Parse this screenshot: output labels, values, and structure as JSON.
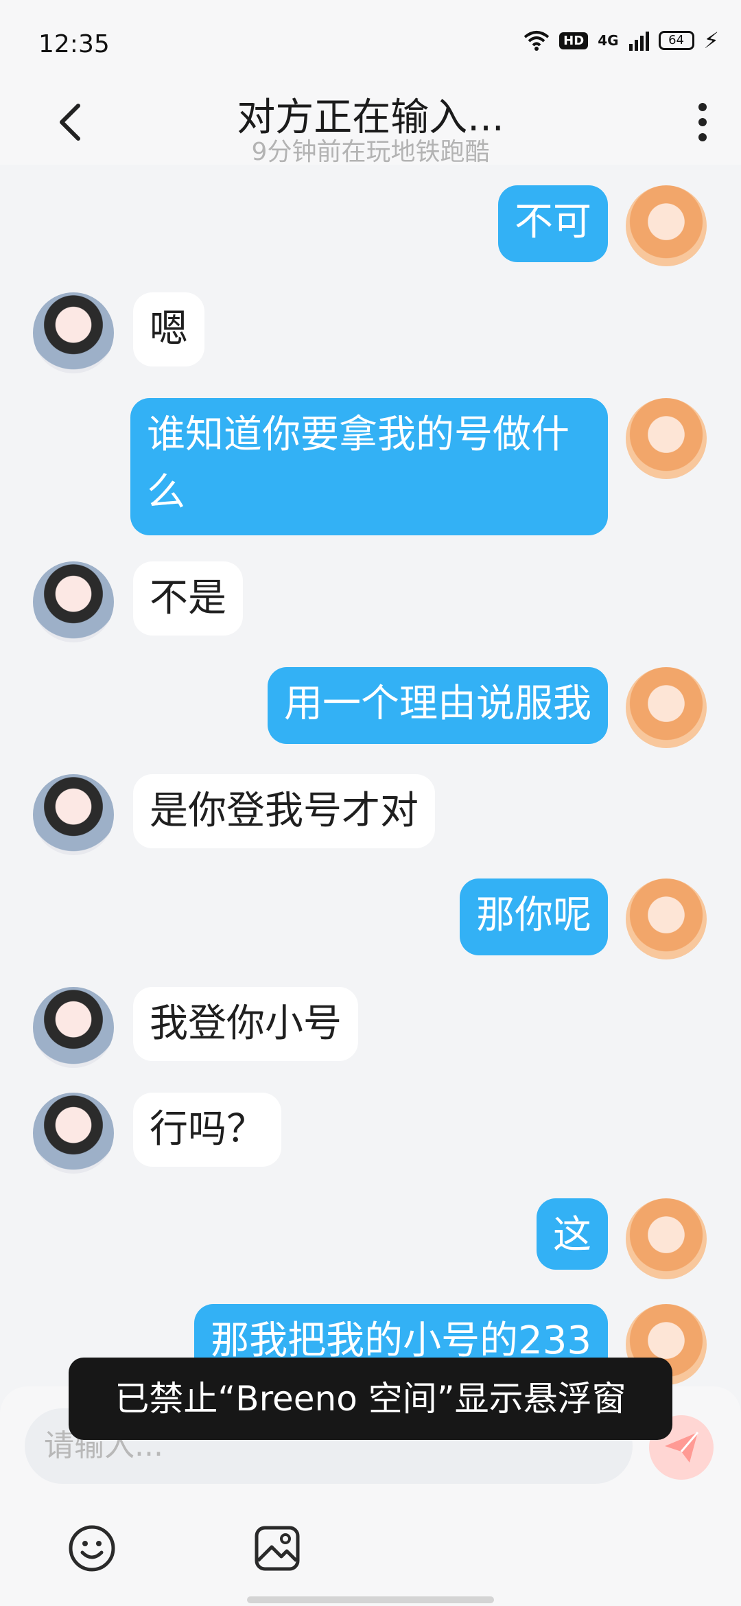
{
  "status_bar": {
    "time": "12:35",
    "hd": "HD",
    "network": "4G",
    "battery": "64"
  },
  "header": {
    "title": "对方正在输入...",
    "subtitle": "9分钟前在玩地铁跑酷"
  },
  "messages": [
    {
      "side": "me",
      "text": "不可"
    },
    {
      "side": "other",
      "text": "嗯"
    },
    {
      "side": "me",
      "text": "谁知道你要拿我的号做什么"
    },
    {
      "side": "other",
      "text": "不是"
    },
    {
      "side": "me",
      "text": "用一个理由说服我"
    },
    {
      "side": "other",
      "text": "是你登我号才对"
    },
    {
      "side": "me",
      "text": "那你呢"
    },
    {
      "side": "other",
      "text": "我登你小号"
    },
    {
      "side": "other",
      "text": "行吗？"
    },
    {
      "side": "me",
      "text": "这"
    },
    {
      "side": "me",
      "text": "那我把我的小号的233"
    }
  ],
  "input": {
    "placeholder": "请输入..."
  },
  "toast": {
    "text": "已禁止“Breeno 空间”显示悬浮窗"
  },
  "colors": {
    "my_bubble": "#33b1f5",
    "other_bubble": "#ffffff",
    "background": "#f3f4f6",
    "send_button": "#ffd6d3"
  }
}
